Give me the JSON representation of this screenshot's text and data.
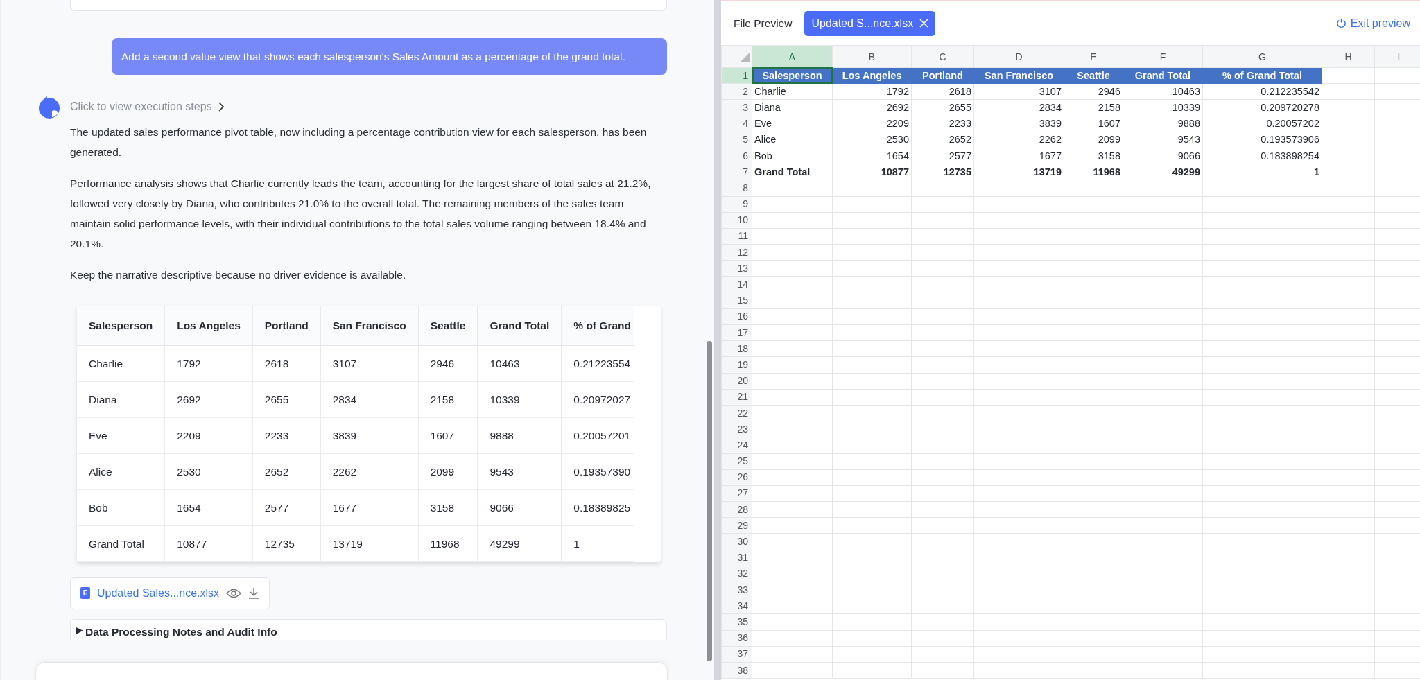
{
  "user_message": "Add a second value view that shows each salesperson's Sales Amount as a percentage of the grand total.",
  "assistant": {
    "steps_link": "Click to view execution steps",
    "paragraphs": [
      "The updated sales performance pivot table, now including a percentage contribution view for each salesperson, has been generated.",
      "Performance analysis shows that Charlie currently leads the team, accounting for the largest share of total sales at 21.2%, followed very closely by Diana, who contributes 21.0% to the overall total. The remaining members of the sales team maintain solid performance levels, with their individual contributions to the total sales volume ranging between 18.4% and 20.1%.",
      "Keep the narrative descriptive because no driver evidence is available."
    ],
    "table": {
      "columns": [
        "Salesperson",
        "Los Angeles",
        "Portland",
        "San Francisco",
        "Seattle",
        "Grand Total",
        "% of Grand"
      ],
      "rows": [
        [
          "Charlie",
          "1792",
          "2618",
          "3107",
          "2946",
          "10463",
          "0.21223554"
        ],
        [
          "Diana",
          "2692",
          "2655",
          "2834",
          "2158",
          "10339",
          "0.20972027"
        ],
        [
          "Eve",
          "2209",
          "2233",
          "3839",
          "1607",
          "9888",
          "0.20057201"
        ],
        [
          "Alice",
          "2530",
          "2652",
          "2262",
          "2099",
          "9543",
          "0.19357390"
        ],
        [
          "Bob",
          "1654",
          "2577",
          "1677",
          "3158",
          "9066",
          "0.18389825"
        ],
        [
          "Grand Total",
          "10877",
          "12735",
          "13719",
          "11968",
          "49299",
          "1"
        ]
      ]
    },
    "attachment": {
      "icon_letter": "E",
      "name": "Updated Sales...nce.xlsx"
    },
    "notes": {
      "marker": "▶",
      "label": "Data Processing Notes and Audit Info",
      "expanded": false
    }
  },
  "preview": {
    "title": "File Preview",
    "tabs": [
      {
        "label": "Updated S...nce.xlsx",
        "selected": true
      }
    ],
    "exit": "Exit preview",
    "sheet": {
      "columns": [
        {
          "label": "A",
          "selected": true
        },
        {
          "label": "B",
          "selected": false
        },
        {
          "label": "C",
          "selected": false
        },
        {
          "label": "D",
          "selected": false
        },
        {
          "label": "E",
          "selected": false
        },
        {
          "label": "F",
          "selected": false
        },
        {
          "label": "G",
          "selected": false
        },
        {
          "label": "H",
          "selected": false
        },
        {
          "label": "I",
          "selected": false
        }
      ],
      "rows": [
        {
          "number": "1",
          "selected": true,
          "kind": "header",
          "cells": [
            "Salesperson",
            "Los Angeles",
            "Portland",
            "San Francisco",
            "Seattle",
            "Grand Total",
            "% of Grand Total"
          ]
        },
        {
          "number": "2",
          "selected": false,
          "kind": "data",
          "cells": [
            "Charlie",
            "1792",
            "2618",
            "3107",
            "2946",
            "10463",
            "0.212235542"
          ]
        },
        {
          "number": "3",
          "selected": false,
          "kind": "data",
          "cells": [
            "Diana",
            "2692",
            "2655",
            "2834",
            "2158",
            "10339",
            "0.209720278"
          ]
        },
        {
          "number": "4",
          "selected": false,
          "kind": "data",
          "cells": [
            "Eve",
            "2209",
            "2233",
            "3839",
            "1607",
            "9888",
            "0.20057202"
          ]
        },
        {
          "number": "5",
          "selected": false,
          "kind": "data",
          "cells": [
            "Alice",
            "2530",
            "2652",
            "2262",
            "2099",
            "9543",
            "0.193573906"
          ]
        },
        {
          "number": "6",
          "selected": false,
          "kind": "data",
          "cells": [
            "Bob",
            "1654",
            "2577",
            "1677",
            "3158",
            "9066",
            "0.183898254"
          ]
        },
        {
          "number": "7",
          "selected": false,
          "kind": "total",
          "cells": [
            "Grand Total",
            "10877",
            "12735",
            "13719",
            "11968",
            "49299",
            "1"
          ]
        },
        {
          "number": "8",
          "selected": false
        },
        {
          "number": "9",
          "selected": false
        },
        {
          "number": "10",
          "selected": false
        },
        {
          "number": "11",
          "selected": false
        },
        {
          "number": "12",
          "selected": false
        },
        {
          "number": "13",
          "selected": false
        },
        {
          "number": "14",
          "selected": false
        },
        {
          "number": "15",
          "selected": false
        },
        {
          "number": "16",
          "selected": false
        },
        {
          "number": "17",
          "selected": false
        },
        {
          "number": "18",
          "selected": false
        },
        {
          "number": "19",
          "selected": false
        },
        {
          "number": "20",
          "selected": false
        },
        {
          "number": "21",
          "selected": false
        },
        {
          "number": "22",
          "selected": false
        },
        {
          "number": "23",
          "selected": false
        },
        {
          "number": "24",
          "selected": false
        },
        {
          "number": "25",
          "selected": false
        },
        {
          "number": "26",
          "selected": false
        },
        {
          "number": "27",
          "selected": false
        },
        {
          "number": "28",
          "selected": false
        },
        {
          "number": "29",
          "selected": false
        },
        {
          "number": "30",
          "selected": false
        },
        {
          "number": "31",
          "selected": false
        },
        {
          "number": "32",
          "selected": false
        },
        {
          "number": "33",
          "selected": false
        },
        {
          "number": "34",
          "selected": false
        },
        {
          "number": "35",
          "selected": false
        },
        {
          "number": "36",
          "selected": false
        },
        {
          "number": "37",
          "selected": false
        },
        {
          "number": "38",
          "selected": false
        }
      ]
    }
  }
}
